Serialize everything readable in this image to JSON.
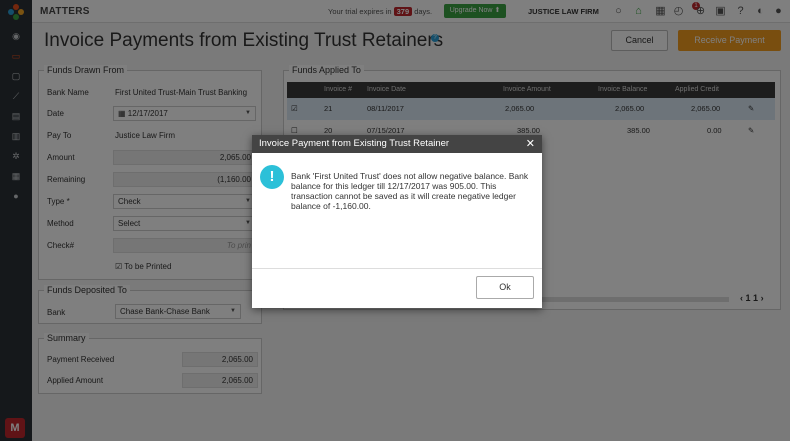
{
  "app": {
    "name": "MATTERS"
  },
  "topbar": {
    "trial_prefix": "Your trial expires in",
    "trial_days": "379",
    "trial_suffix": "days.",
    "upgrade_label": "Upgrade Now",
    "firm_name": "JUSTICE LAW FIRM",
    "notification_count": "1"
  },
  "page": {
    "title": "Invoice Payments from Existing Trust Retainers",
    "help": "?"
  },
  "actions": {
    "cancel": "Cancel",
    "receive": "Receive Payment"
  },
  "funds_drawn": {
    "legend": "Funds Drawn From",
    "bank_name_label": "Bank Name",
    "bank_name_value": "First United Trust-Main Trust Banking",
    "date_label": "Date",
    "date_value": "12/17/2017",
    "payto_label": "Pay To",
    "payto_value": "Justice Law Firm",
    "amount_label": "Amount",
    "amount_value": "2,065.00",
    "remaining_label": "Remaining",
    "remaining_value": "(1,160.00",
    "type_label": "Type *",
    "type_value": "Check",
    "method_label": "Method",
    "method_value": "Select",
    "check_label": "Check#",
    "check_value": "To prin",
    "to_be_printed": "To be Printed"
  },
  "funds_deposited": {
    "legend": "Funds Deposited To",
    "bank_label": "Bank",
    "bank_value": "Chase Bank-Chase Bank"
  },
  "summary": {
    "legend": "Summary",
    "payment_received_label": "Payment Received",
    "payment_received_value": "2,065.00",
    "applied_amount_label": "Applied Amount",
    "applied_amount_value": "2,065.00"
  },
  "funds_applied": {
    "legend": "Funds Applied To",
    "columns": [
      "Invoice #",
      "Invoice Date",
      "Invoice Amount",
      "Invoice Balance",
      "Applied Credit"
    ],
    "rows": [
      {
        "num": "21",
        "date": "08/11/2017",
        "amount": "2,065.00",
        "balance": "2,065.00",
        "credit": "2,065.00"
      },
      {
        "num": "20",
        "date": "07/15/2017",
        "amount": "385.00",
        "balance": "385.00",
        "credit": "0.00"
      }
    ],
    "pager": "1",
    "pager_total": "1"
  },
  "modal": {
    "title": "Invoice Payment from Existing Trust Retainer",
    "message": "Bank 'First United Trust' does not allow negative balance. Bank balance for this ledger till 12/17/2017 was 905.00. This transaction cannot be saved as it will create negative ledger balance of -1,160.00.",
    "ok": "Ok"
  },
  "colors": {
    "accent": "#f39c1f",
    "upgrade": "#3aa343",
    "sidebar": "#2b3036",
    "info": "#2cc0d8"
  }
}
